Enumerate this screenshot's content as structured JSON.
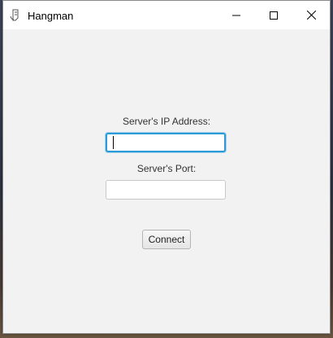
{
  "window": {
    "title": "Hangman",
    "icon": "java-app-icon"
  },
  "titlebar_controls": [
    "minimize-icon",
    "maximize-icon",
    "close-icon"
  ],
  "form": {
    "ip_label": "Server's IP Address:",
    "ip_value": "",
    "port_label": "Server's Port:",
    "port_value": "",
    "connect_label": "Connect"
  },
  "colors": {
    "focus_border": "#2e9ad6",
    "window_bg": "#f2f2f2",
    "titlebar_bg": "#ffffff"
  }
}
